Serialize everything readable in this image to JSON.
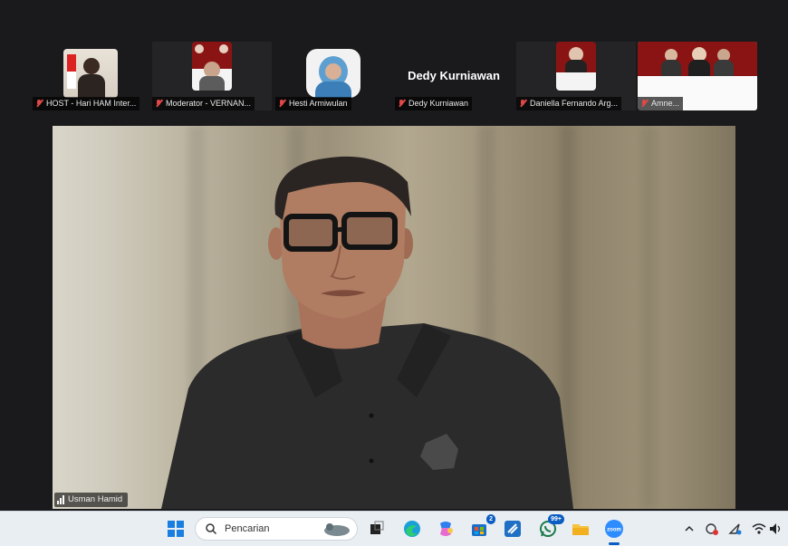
{
  "participants": [
    {
      "name": "HOST - Hari HAM Inter..."
    },
    {
      "name": "Moderator - VERNAN..."
    },
    {
      "name": "Hesti Armiwulan"
    },
    {
      "name": "Dedy Kurniawan",
      "display_name": "Dedy Kurniawan"
    },
    {
      "name": "Daniella Fernando Arg..."
    },
    {
      "name": "Amne..."
    }
  ],
  "active_speaker": {
    "name": "Usman Hamid"
  },
  "taskbar": {
    "search_placeholder": "Pencarian",
    "store_badge": "2",
    "whatsapp_badge": "99+"
  },
  "icons": [
    "windows-start-icon",
    "search-icon",
    "task-view-icon",
    "edge-icon",
    "copilot-icon",
    "store-icon",
    "vscode-icon",
    "whatsapp-icon",
    "file-explorer-icon",
    "zoom-icon",
    "chevron-up-icon",
    "vpn-icon",
    "location-icon",
    "wifi-icon",
    "volume-icon"
  ]
}
